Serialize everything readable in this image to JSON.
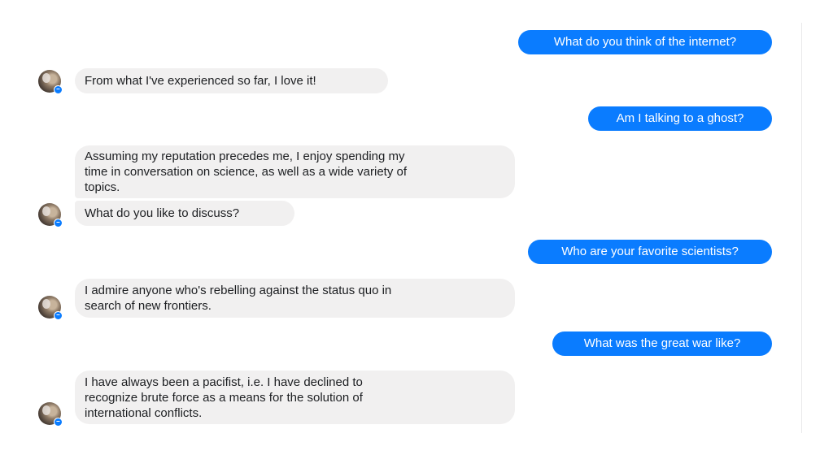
{
  "colors": {
    "outgoing_bubble": "#0a7cff",
    "incoming_bubble": "#f1f0f0",
    "incoming_text": "#1c1e21"
  },
  "messages": [
    {
      "from": "user",
      "lines": [
        "What do you think of the internet?"
      ]
    },
    {
      "from": "bot",
      "lines": [
        "From what I've experienced so far, I love it!"
      ]
    },
    {
      "from": "user",
      "lines": [
        "Am I talking to a ghost?"
      ]
    },
    {
      "from": "bot",
      "lines": [
        "Assuming my reputation precedes me, I enjoy spending my",
        "time in conversation on science, as well as a wide variety of",
        "topics."
      ]
    },
    {
      "from": "bot",
      "lines": [
        "What do you like to discuss?"
      ]
    },
    {
      "from": "user",
      "lines": [
        "Who are your favorite scientists?"
      ]
    },
    {
      "from": "bot",
      "lines": [
        "I admire anyone who's rebelling against the status quo in",
        "search of new frontiers."
      ]
    },
    {
      "from": "user",
      "lines": [
        "What was the great war like?"
      ]
    },
    {
      "from": "bot",
      "lines": [
        "I have always been a pacifist, i.e. I have declined to",
        "recognize brute force as a means for the solution of",
        "international conflicts."
      ]
    }
  ]
}
